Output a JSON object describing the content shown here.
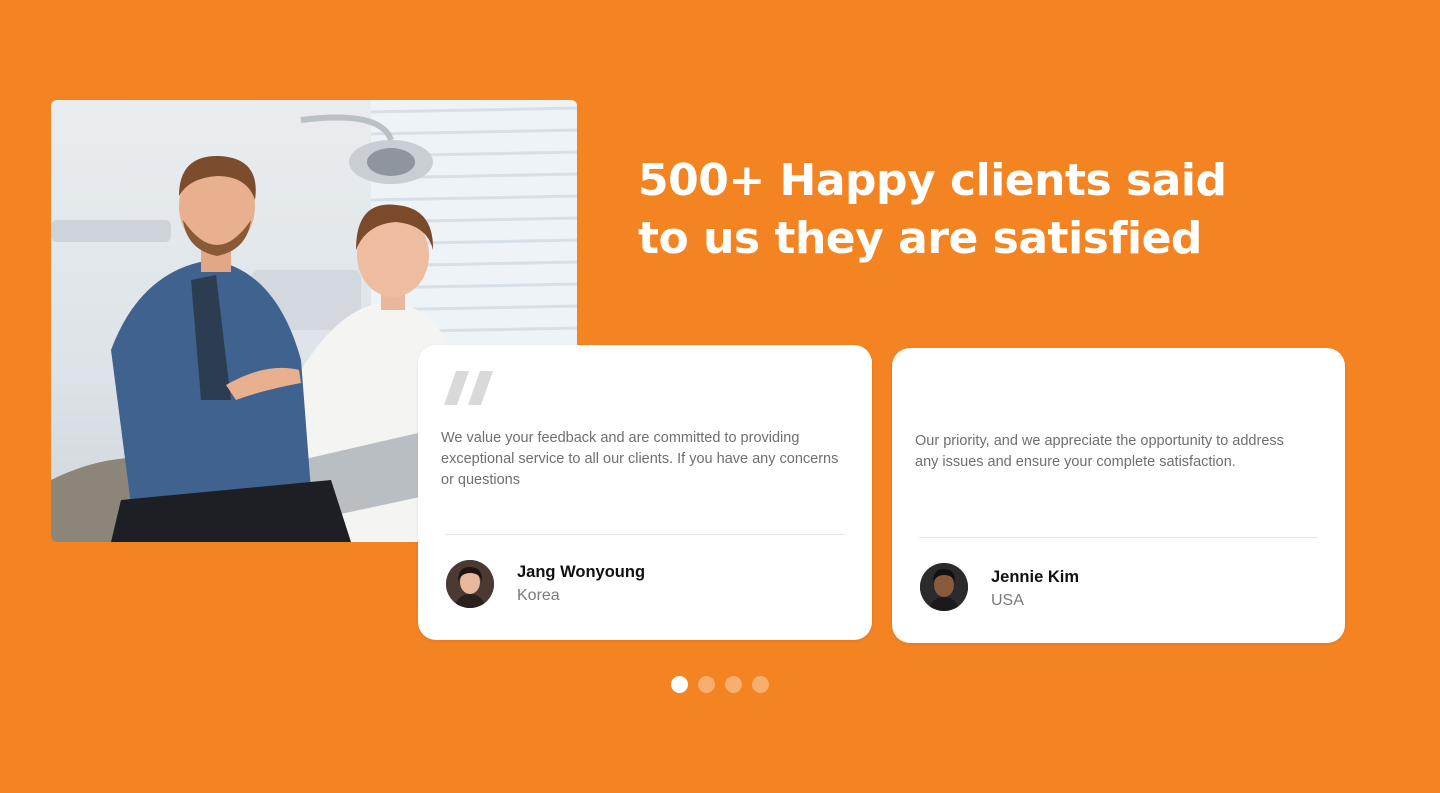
{
  "heading": {
    "line1": "500+ Happy clients said",
    "line2": "to us they are satisfied"
  },
  "testimonials": [
    {
      "text": "We value your feedback and are committed to providing exceptional service to all our clients. If you have any concerns or questions",
      "name": "Jang Wonyoung",
      "country": "Korea"
    },
    {
      "text": "Our priority, and we appreciate the opportunity to address any issues and ensure your complete satisfaction.",
      "name": "Jennie Kim",
      "country": "USA"
    }
  ],
  "pagination": {
    "count": 4,
    "active_index": 0
  },
  "colors": {
    "background": "#F48322",
    "card": "#FFFFFF",
    "quote_mark": "#D9D9D9",
    "dot_active": "#FFFFFF"
  },
  "icons": {
    "quote": "quote-icon"
  }
}
